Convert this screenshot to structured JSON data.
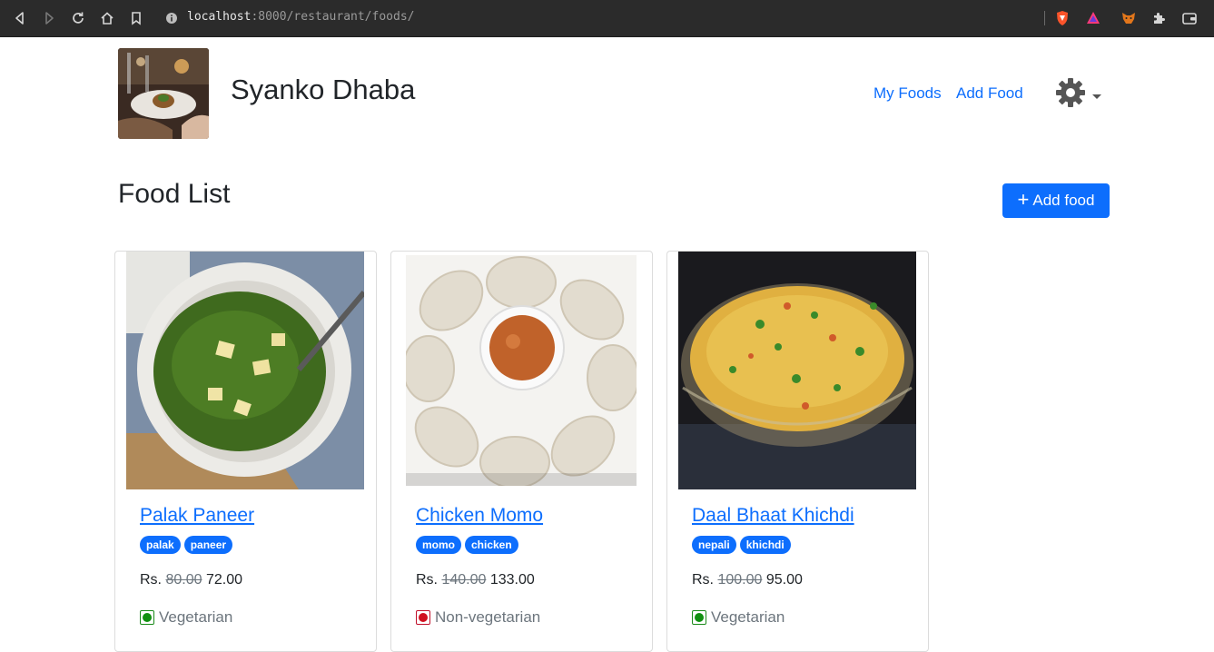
{
  "browser": {
    "url_host": "localhost",
    "url_rest": ":8000/restaurant/foods/"
  },
  "header": {
    "brand": "Syanko Dhaba",
    "nav": {
      "my_foods": "My Foods",
      "add_food": "Add Food"
    }
  },
  "page": {
    "title": "Food List",
    "add_button_label": "Add food"
  },
  "foods": [
    {
      "name": "Palak Paneer",
      "tags": [
        "palak",
        "paneer"
      ],
      "currency": "Rs.",
      "old_price": "80.00",
      "price": "72.00",
      "diet": "Vegetarian"
    },
    {
      "name": "Chicken Momo",
      "tags": [
        "momo",
        "chicken"
      ],
      "currency": "Rs.",
      "old_price": "140.00",
      "price": "133.00",
      "diet": "Non-vegetarian"
    },
    {
      "name": "Daal Bhaat Khichdi",
      "tags": [
        "nepali",
        "khichdi"
      ],
      "currency": "Rs.",
      "old_price": "100.00",
      "price": "95.00",
      "diet": "Vegetarian"
    }
  ],
  "colors": {
    "primary": "#0d6efd",
    "veg": "#109010",
    "nonveg": "#d01020"
  }
}
